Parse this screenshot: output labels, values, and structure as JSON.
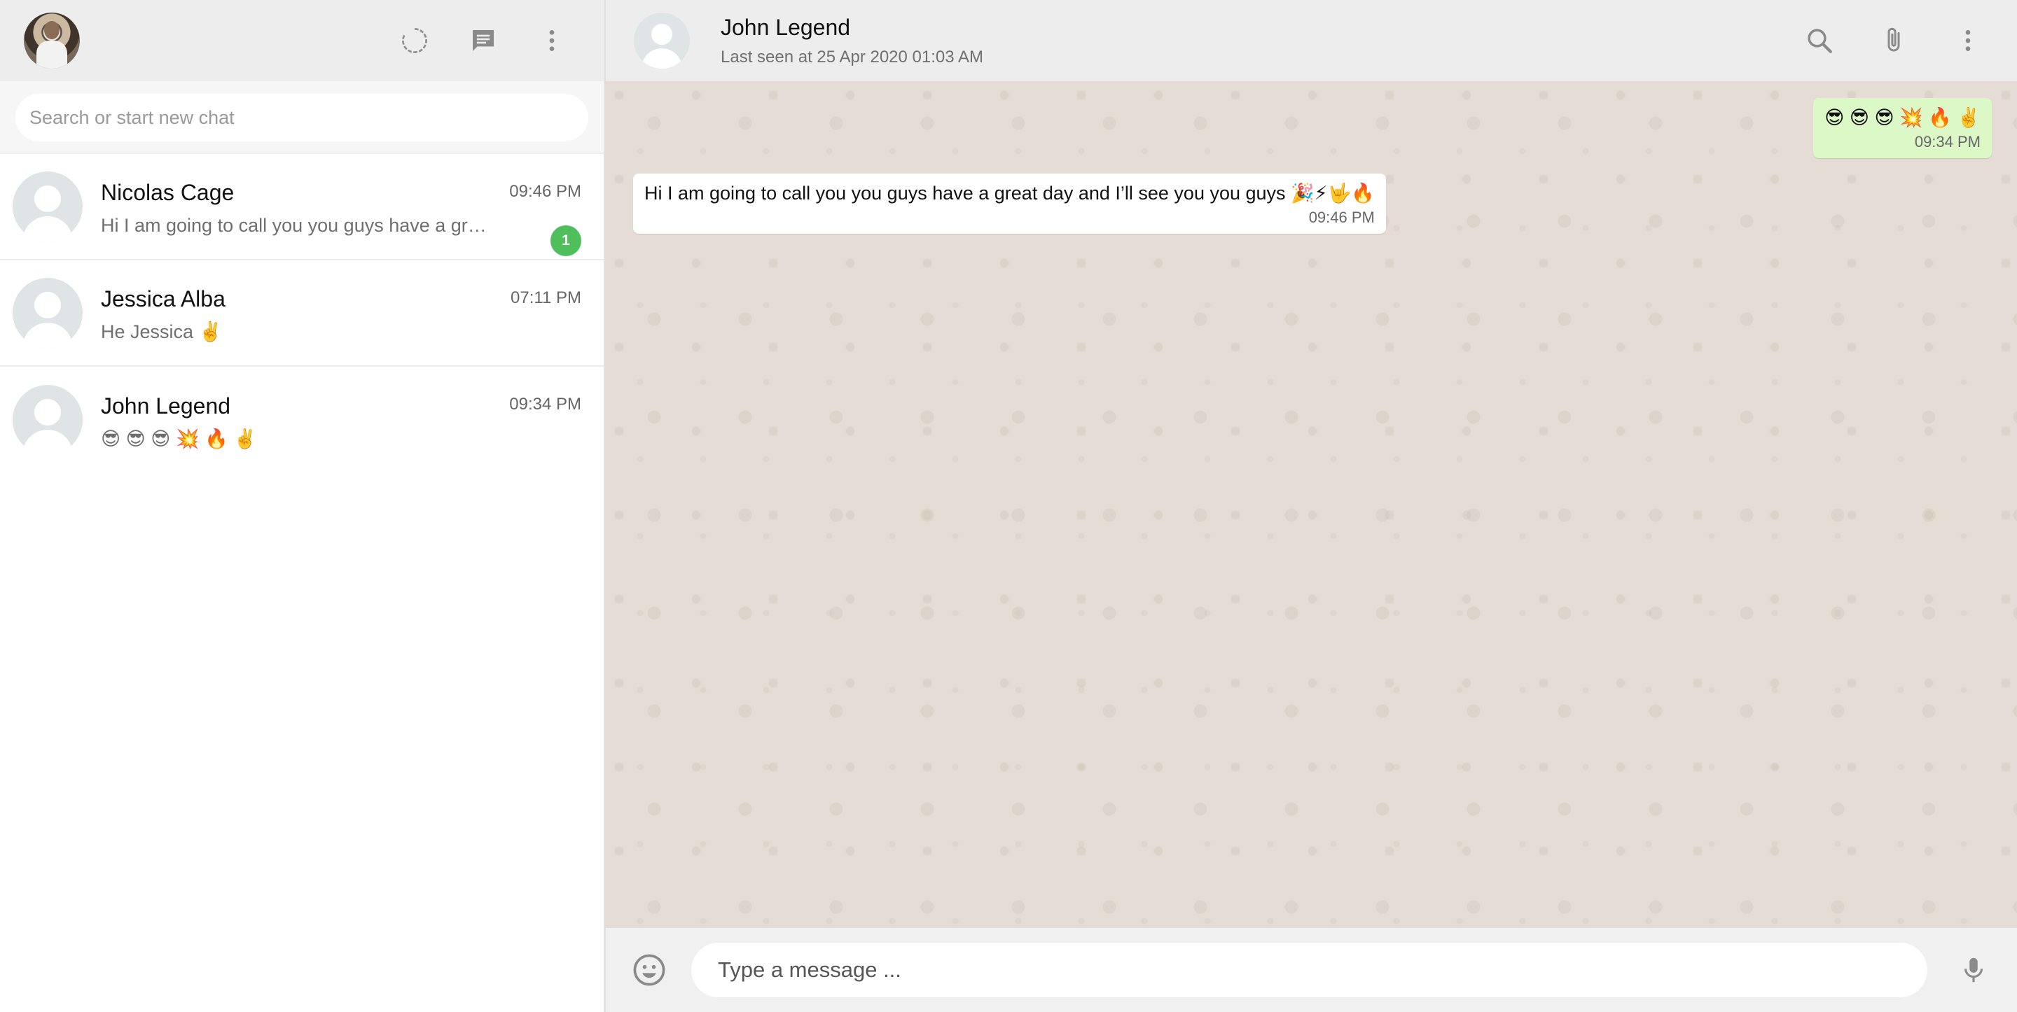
{
  "sidebar": {
    "search": {
      "placeholder": "Search or start new chat"
    },
    "chats": [
      {
        "name": "Nicolas Cage",
        "preview": "Hi I am going to call you you guys have a great day and I’ll see you you guys 🎉⚡🤟🔥",
        "time": "09:46 PM",
        "unread": "1"
      },
      {
        "name": "Jessica Alba",
        "preview": "He Jessica ✌️",
        "time": "07:11 PM"
      },
      {
        "name": "John Legend",
        "preview": "😎 😎 😎 💥 🔥 ✌️",
        "time": "09:34 PM"
      }
    ]
  },
  "header": {
    "name": "John Legend",
    "status": "Last seen at 25 Apr 2020 01:03 AM"
  },
  "messages": [
    {
      "direction": "out",
      "text": "😎 😎 😎 💥 🔥 ✌️",
      "time": "09:34 PM"
    },
    {
      "direction": "in",
      "text": "Hi I am going to call you you guys have a great day and I’ll see you you guys 🎉⚡🤟🔥",
      "time": "09:46 PM"
    }
  ],
  "composer": {
    "placeholder": "Type a message ..."
  },
  "icons": {
    "status": "status-icon",
    "new_chat": "new-chat-icon",
    "menu": "more-vertical-icon",
    "search": "search-icon",
    "attach": "paperclip-icon",
    "emoji": "emoji-icon",
    "mic": "microphone-icon"
  },
  "colors": {
    "unread_badge": "#4fbf5b",
    "outgoing_bubble": "#dcf8c6",
    "chat_background": "#e5ddd5"
  }
}
